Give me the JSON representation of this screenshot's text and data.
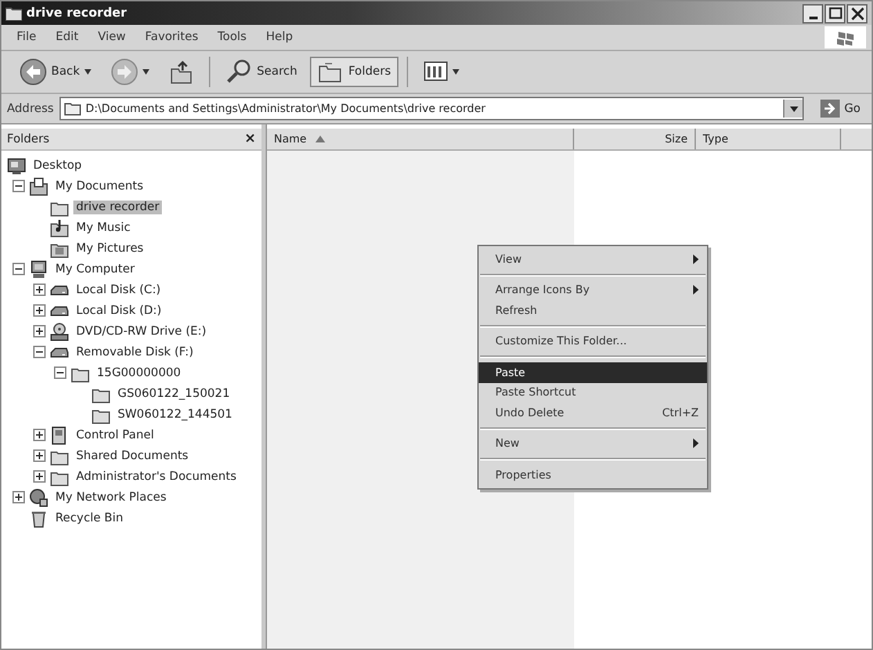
{
  "window": {
    "title": "drive recorder"
  },
  "menu": [
    "File",
    "Edit",
    "View",
    "Favorites",
    "Tools",
    "Help"
  ],
  "toolbar": [
    {
      "kind": "back",
      "label": "Back",
      "selected": false
    },
    {
      "kind": "forward",
      "selected": false
    },
    {
      "kind": "up",
      "selected": false
    },
    {
      "kind": "search",
      "label": "Search",
      "selected": false
    },
    {
      "kind": "folders",
      "label": "Folders",
      "selected": true
    },
    {
      "kind": "views",
      "selected": false
    }
  ],
  "address": {
    "label": "Address",
    "value": "D:\\Documents and Settings\\Administrator\\My Documents\\drive recorder",
    "go": "Go"
  },
  "folders_pane": {
    "title": "Folders",
    "close": "×"
  },
  "tree": [
    {
      "label": "Desktop",
      "kind": "desktop",
      "selected": false,
      "children": [
        {
          "label": "My Documents",
          "kind": "documents",
          "selected": false,
          "expanded": true,
          "children": [
            {
              "label": "drive recorder",
              "kind": "folder",
              "selected": true
            },
            {
              "label": "My Music",
              "kind": "music",
              "selected": false
            },
            {
              "label": "My Pictures",
              "kind": "pictures",
              "selected": false
            }
          ]
        },
        {
          "label": "My Computer",
          "kind": "computer",
          "selected": false,
          "expanded": true,
          "children": [
            {
              "label": "Local Disk (C:)",
              "kind": "drive",
              "selected": false,
              "expanded": false
            },
            {
              "label": "Local Disk (D:)",
              "kind": "drive",
              "selected": false,
              "expanded": false
            },
            {
              "label": "DVD/CD-RW Drive (E:)",
              "kind": "cdrom",
              "selected": false,
              "expanded": false
            },
            {
              "label": "Removable Disk (F:)",
              "kind": "drive",
              "selected": false,
              "expanded": true,
              "children": [
                {
                  "label": "15G00000000",
                  "kind": "folder",
                  "selected": false,
                  "expanded": true,
                  "children": [
                    {
                      "label": "GS060122_150021",
                      "kind": "folder",
                      "selected": false
                    },
                    {
                      "label": "SW060122_144501",
                      "kind": "folder",
                      "selected": false
                    }
                  ]
                }
              ]
            },
            {
              "label": "Control Panel",
              "kind": "control",
              "selected": false,
              "expanded": false
            },
            {
              "label": "Shared Documents",
              "kind": "folder",
              "selected": false,
              "expanded": false
            },
            {
              "label": "Administrator's Documents",
              "kind": "folder",
              "selected": false,
              "expanded": false
            }
          ]
        },
        {
          "label": "My Network Places",
          "kind": "network",
          "selected": false,
          "expanded": false
        },
        {
          "label": "Recycle Bin",
          "kind": "recycle",
          "selected": false
        }
      ]
    }
  ],
  "list": {
    "columns": [
      {
        "label": "Name",
        "sorted": true
      },
      {
        "label": "Size",
        "sorted": false
      },
      {
        "label": "Type",
        "sorted": false
      }
    ]
  },
  "context_menu": [
    {
      "kind": "item",
      "label": "View",
      "submenu": true,
      "selected": false
    },
    {
      "kind": "separator"
    },
    {
      "kind": "item",
      "label": "Arrange Icons By",
      "submenu": true,
      "selected": false
    },
    {
      "kind": "item",
      "label": "Refresh",
      "submenu": false,
      "selected": false
    },
    {
      "kind": "separator"
    },
    {
      "kind": "item",
      "label": "Customize This Folder...",
      "submenu": false,
      "selected": false
    },
    {
      "kind": "separator"
    },
    {
      "kind": "item",
      "label": "Paste",
      "submenu": false,
      "selected": true
    },
    {
      "kind": "item",
      "label": "Paste Shortcut",
      "submenu": false,
      "selected": false
    },
    {
      "kind": "item",
      "label": "Undo Delete",
      "shortcut": "Ctrl+Z",
      "submenu": false,
      "selected": false
    },
    {
      "kind": "separator"
    },
    {
      "kind": "item",
      "label": "New",
      "submenu": true,
      "selected": false
    },
    {
      "kind": "separator"
    },
    {
      "kind": "item",
      "label": "Properties",
      "submenu": false,
      "selected": false
    }
  ]
}
